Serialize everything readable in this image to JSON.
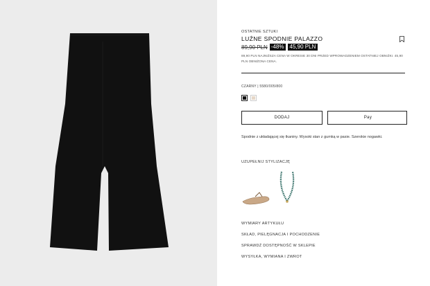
{
  "product": {
    "badge": "OSTATNIE SZTUKI",
    "title": "LUŹNE SPODNIE PALAZZO",
    "old_price": "89,90 PLN",
    "discount": "-48%",
    "new_price": "45,90 PLN",
    "price_note": "89,90 PLN NAJNIŻSZA CENA W OKRESIE 30 DNI PRZED WPROWADZENIEM OSTATNIEJ OBNIŻKI. 45,90 PLN OBNIŻONA CENA.",
    "color_line": "CZARNY | 5580/005/800",
    "description": "Spodnie z układającej się tkaniny. Wysoki stan z gumką w pasie. Szerokie nogawki."
  },
  "swatches": [
    {
      "name": "black",
      "color": "#111111"
    },
    {
      "name": "beige",
      "color": "#e6d7c8"
    }
  ],
  "actions": {
    "add_label": "DODAJ",
    "pay_label": "Pay",
    "apple_icon": ""
  },
  "styling": {
    "title": "UZUPEŁNIJ STYLIZACJĘ",
    "items": [
      "sandal-icon",
      "necklace-icon"
    ]
  },
  "links": [
    "WYMIARY ARTYKUŁU",
    "SKŁAD, PIELĘGNACJA I POCHODZENIE",
    "SPRAWDŹ DOSTĘPNOŚĆ W SKLEPIE",
    "WYSYŁKA, WYMIANA I ZWROT"
  ],
  "colors": {
    "gallery_bg": "#ececec",
    "product": "#111111",
    "accent": "#111111"
  }
}
